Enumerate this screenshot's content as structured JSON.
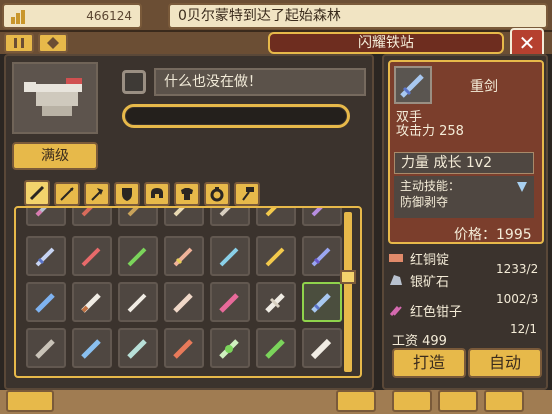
{
  "header": {
    "gold": "466124",
    "news": "0贝尔蒙特到达了起始森林"
  },
  "window": {
    "title": "闪耀铁站",
    "close_label": "✕"
  },
  "character": {
    "max_button": "满级",
    "status_text": "什么也没在做！"
  },
  "category_tabs": [
    "sword-icon",
    "spear-icon",
    "axe-icon",
    "shield-icon",
    "helmet-icon",
    "armor-icon",
    "ring-icon",
    "hammer-icon"
  ],
  "item": {
    "name": "重剑",
    "hand": "双手",
    "attack": "攻击力 258",
    "stat": "力量 成长 1v2",
    "skill_label": "主动技能：",
    "skill": "防御剥夺",
    "price": "价格：1995"
  },
  "materials": [
    {
      "name": "红铜锭",
      "count": "",
      "icon_color": "#e08a6a"
    },
    {
      "name": "银矿石",
      "count": "1233/2",
      "icon_color": "#b9c2cf"
    },
    {
      "name": "红色钳子",
      "count": "1002/3",
      "icon_color": "#d56ab0"
    }
  ],
  "wage": "工资 499",
  "wage_count": "12/1",
  "buttons": {
    "forge": "打造",
    "auto": "自动"
  },
  "colors": {
    "gold": "#e7b94a",
    "panel": "#3b332d",
    "accent": "#7b3e2c",
    "selected": "#8fd34c"
  }
}
